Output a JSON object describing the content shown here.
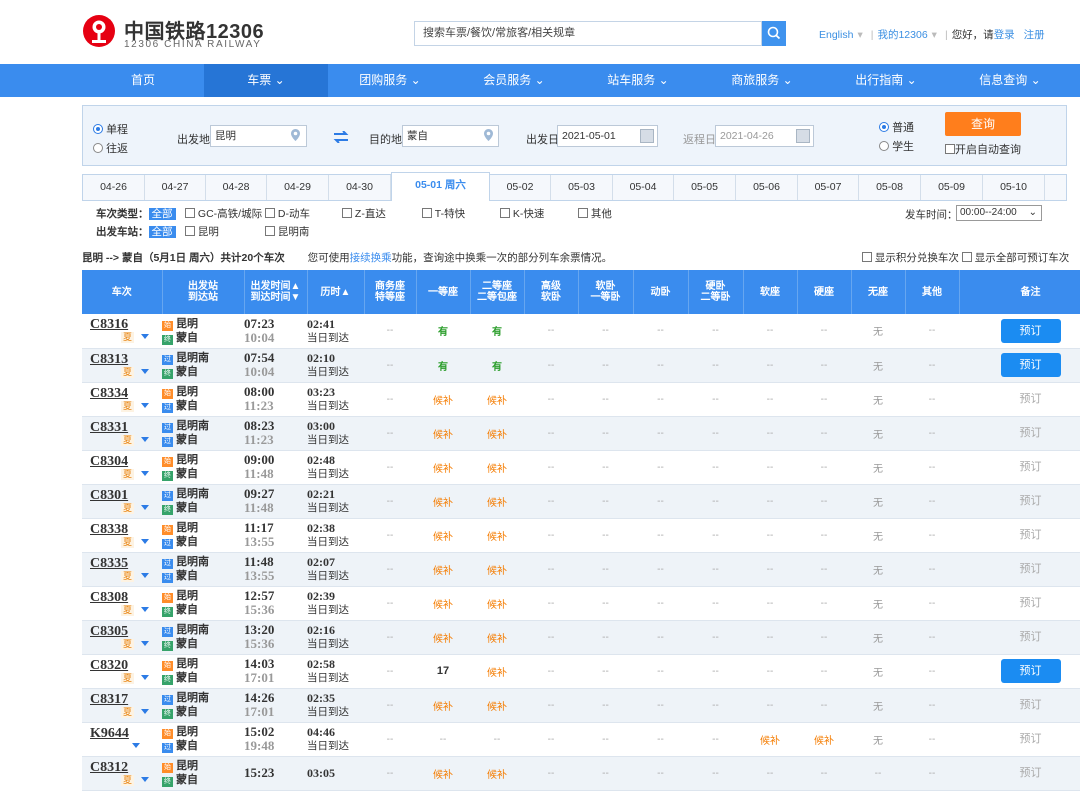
{
  "header": {
    "logo_cn": "中国铁路12306",
    "logo_en": "12306 CHINA RAILWAY",
    "search_placeholder": "搜索车票/餐饮/常旅客/相关规章",
    "english": "English",
    "my12306": "我的12306",
    "greeting": "您好，请",
    "login": "登录",
    "register": "注册"
  },
  "nav": [
    "首页",
    "车票",
    "团购服务",
    "会员服务",
    "站车服务",
    "商旅服务",
    "出行指南",
    "信息查询"
  ],
  "form": {
    "oneway": "单程",
    "roundtrip": "往返",
    "from_label": "出发地",
    "from_value": "昆明",
    "to_label": "目的地",
    "to_value": "蒙自",
    "depart_label": "出发日",
    "depart_value": "2021-05-01",
    "return_label": "返程日",
    "return_value": "2021-04-26",
    "normal": "普通",
    "student": "学生",
    "query": "查询",
    "auto_query": "开启自动查询"
  },
  "dates": [
    "04-26",
    "04-27",
    "04-28",
    "04-29",
    "04-30",
    "05-01 周六",
    "05-02",
    "05-03",
    "05-04",
    "05-05",
    "05-06",
    "05-07",
    "05-08",
    "05-09",
    "05-10"
  ],
  "filters": {
    "type_label": "车次类型：",
    "all": "全部",
    "types": [
      "GC-高铁/城际",
      "D-动车",
      "Z-直达",
      "T-特快",
      "K-快速",
      "其他"
    ],
    "station_label": "出发车站：",
    "stations": [
      "昆明",
      "昆明南"
    ],
    "time_label": "发车时间：",
    "time_value": "00:00--24:00"
  },
  "summary": {
    "route": "昆明 --> 蒙自（5月1日  周六）共计20个车次",
    "hint_pre": "您可使用",
    "hint_link": "接续换乘",
    "hint_post": "功能，查询途中换乘一次的部分列车余票情况。",
    "show_points": "显示积分兑换车次",
    "show_all": "显示全部可预订车次"
  },
  "columns": [
    "车次",
    "出发站\n到达站",
    "出发时间▲\n到达时间▼",
    "历时▲",
    "商务座\n特等座",
    "一等座",
    "二等座\n二等包座",
    "高级\n软卧",
    "软卧\n一等卧",
    "动卧",
    "硬卧\n二等卧",
    "软座",
    "硬座",
    "无座",
    "其他",
    "备注"
  ],
  "trains": [
    {
      "no": "C8316",
      "tag": "夏",
      "from_type": "始",
      "from": "昆明",
      "to_type": "终",
      "to": "蒙自",
      "dep": "07:23",
      "arr": "10:04",
      "dur": "02:41",
      "day": "当日到达",
      "seats": [
        "--",
        "有",
        "有",
        "--",
        "--",
        "--",
        "--",
        "--",
        "--",
        "无",
        "--"
      ],
      "book": "预订",
      "bookable": true
    },
    {
      "no": "C8313",
      "tag": "夏",
      "from_type": "过",
      "from": "昆明南",
      "to_type": "终",
      "to": "蒙自",
      "dep": "07:54",
      "arr": "10:04",
      "dur": "02:10",
      "day": "当日到达",
      "seats": [
        "--",
        "有",
        "有",
        "--",
        "--",
        "--",
        "--",
        "--",
        "--",
        "无",
        "--"
      ],
      "book": "预订",
      "bookable": true
    },
    {
      "no": "C8334",
      "tag": "夏",
      "from_type": "始",
      "from": "昆明",
      "to_type": "过",
      "to": "蒙自",
      "dep": "08:00",
      "arr": "11:23",
      "dur": "03:23",
      "day": "当日到达",
      "seats": [
        "--",
        "候补",
        "候补",
        "--",
        "--",
        "--",
        "--",
        "--",
        "--",
        "无",
        "--"
      ],
      "book": "预订",
      "bookable": false
    },
    {
      "no": "C8331",
      "tag": "夏",
      "from_type": "过",
      "from": "昆明南",
      "to_type": "过",
      "to": "蒙自",
      "dep": "08:23",
      "arr": "11:23",
      "dur": "03:00",
      "day": "当日到达",
      "seats": [
        "--",
        "候补",
        "候补",
        "--",
        "--",
        "--",
        "--",
        "--",
        "--",
        "无",
        "--"
      ],
      "book": "预订",
      "bookable": false
    },
    {
      "no": "C8304",
      "tag": "夏",
      "from_type": "始",
      "from": "昆明",
      "to_type": "终",
      "to": "蒙自",
      "dep": "09:00",
      "arr": "11:48",
      "dur": "02:48",
      "day": "当日到达",
      "seats": [
        "--",
        "候补",
        "候补",
        "--",
        "--",
        "--",
        "--",
        "--",
        "--",
        "无",
        "--"
      ],
      "book": "预订",
      "bookable": false
    },
    {
      "no": "C8301",
      "tag": "夏",
      "from_type": "过",
      "from": "昆明南",
      "to_type": "终",
      "to": "蒙自",
      "dep": "09:27",
      "arr": "11:48",
      "dur": "02:21",
      "day": "当日到达",
      "seats": [
        "--",
        "候补",
        "候补",
        "--",
        "--",
        "--",
        "--",
        "--",
        "--",
        "无",
        "--"
      ],
      "book": "预订",
      "bookable": false
    },
    {
      "no": "C8338",
      "tag": "夏",
      "from_type": "始",
      "from": "昆明",
      "to_type": "过",
      "to": "蒙自",
      "dep": "11:17",
      "arr": "13:55",
      "dur": "02:38",
      "day": "当日到达",
      "seats": [
        "--",
        "候补",
        "候补",
        "--",
        "--",
        "--",
        "--",
        "--",
        "--",
        "无",
        "--"
      ],
      "book": "预订",
      "bookable": false
    },
    {
      "no": "C8335",
      "tag": "夏",
      "from_type": "过",
      "from": "昆明南",
      "to_type": "过",
      "to": "蒙自",
      "dep": "11:48",
      "arr": "13:55",
      "dur": "02:07",
      "day": "当日到达",
      "seats": [
        "--",
        "候补",
        "候补",
        "--",
        "--",
        "--",
        "--",
        "--",
        "--",
        "无",
        "--"
      ],
      "book": "预订",
      "bookable": false
    },
    {
      "no": "C8308",
      "tag": "夏",
      "from_type": "始",
      "from": "昆明",
      "to_type": "终",
      "to": "蒙自",
      "dep": "12:57",
      "arr": "15:36",
      "dur": "02:39",
      "day": "当日到达",
      "seats": [
        "--",
        "候补",
        "候补",
        "--",
        "--",
        "--",
        "--",
        "--",
        "--",
        "无",
        "--"
      ],
      "book": "预订",
      "bookable": false
    },
    {
      "no": "C8305",
      "tag": "夏",
      "from_type": "过",
      "from": "昆明南",
      "to_type": "终",
      "to": "蒙自",
      "dep": "13:20",
      "arr": "15:36",
      "dur": "02:16",
      "day": "当日到达",
      "seats": [
        "--",
        "候补",
        "候补",
        "--",
        "--",
        "--",
        "--",
        "--",
        "--",
        "无",
        "--"
      ],
      "book": "预订",
      "bookable": false
    },
    {
      "no": "C8320",
      "tag": "夏",
      "from_type": "始",
      "from": "昆明",
      "to_type": "终",
      "to": "蒙自",
      "dep": "14:03",
      "arr": "17:01",
      "dur": "02:58",
      "day": "当日到达",
      "seats": [
        "--",
        "17",
        "候补",
        "--",
        "--",
        "--",
        "--",
        "--",
        "--",
        "无",
        "--"
      ],
      "book": "预订",
      "bookable": true
    },
    {
      "no": "C8317",
      "tag": "夏",
      "from_type": "过",
      "from": "昆明南",
      "to_type": "终",
      "to": "蒙自",
      "dep": "14:26",
      "arr": "17:01",
      "dur": "02:35",
      "day": "当日到达",
      "seats": [
        "--",
        "候补",
        "候补",
        "--",
        "--",
        "--",
        "--",
        "--",
        "--",
        "无",
        "--"
      ],
      "book": "预订",
      "bookable": false
    },
    {
      "no": "K9644",
      "tag": "",
      "from_type": "始",
      "from": "昆明",
      "to_type": "过",
      "to": "蒙自",
      "dep": "15:02",
      "arr": "19:48",
      "dur": "04:46",
      "day": "当日到达",
      "seats": [
        "--",
        "--",
        "--",
        "--",
        "--",
        "--",
        "--",
        "候补",
        "候补",
        "无",
        "--"
      ],
      "book": "预订",
      "bookable": false
    },
    {
      "no": "C8312",
      "tag": "夏",
      "from_type": "始",
      "from": "昆明",
      "to_type": "终",
      "to": "蒙自",
      "dep": "15:23",
      "arr": "",
      "dur": "03:05",
      "day": "",
      "seats": [
        "--",
        "候补",
        "候补",
        "--",
        "--",
        "--",
        "--",
        "--",
        "--",
        "--",
        "--"
      ],
      "book": "预订",
      "bookable": false
    }
  ],
  "colors": {
    "accent": "#3a8cee",
    "orange": "#ff7e1c",
    "green": "#2a9d2a"
  }
}
